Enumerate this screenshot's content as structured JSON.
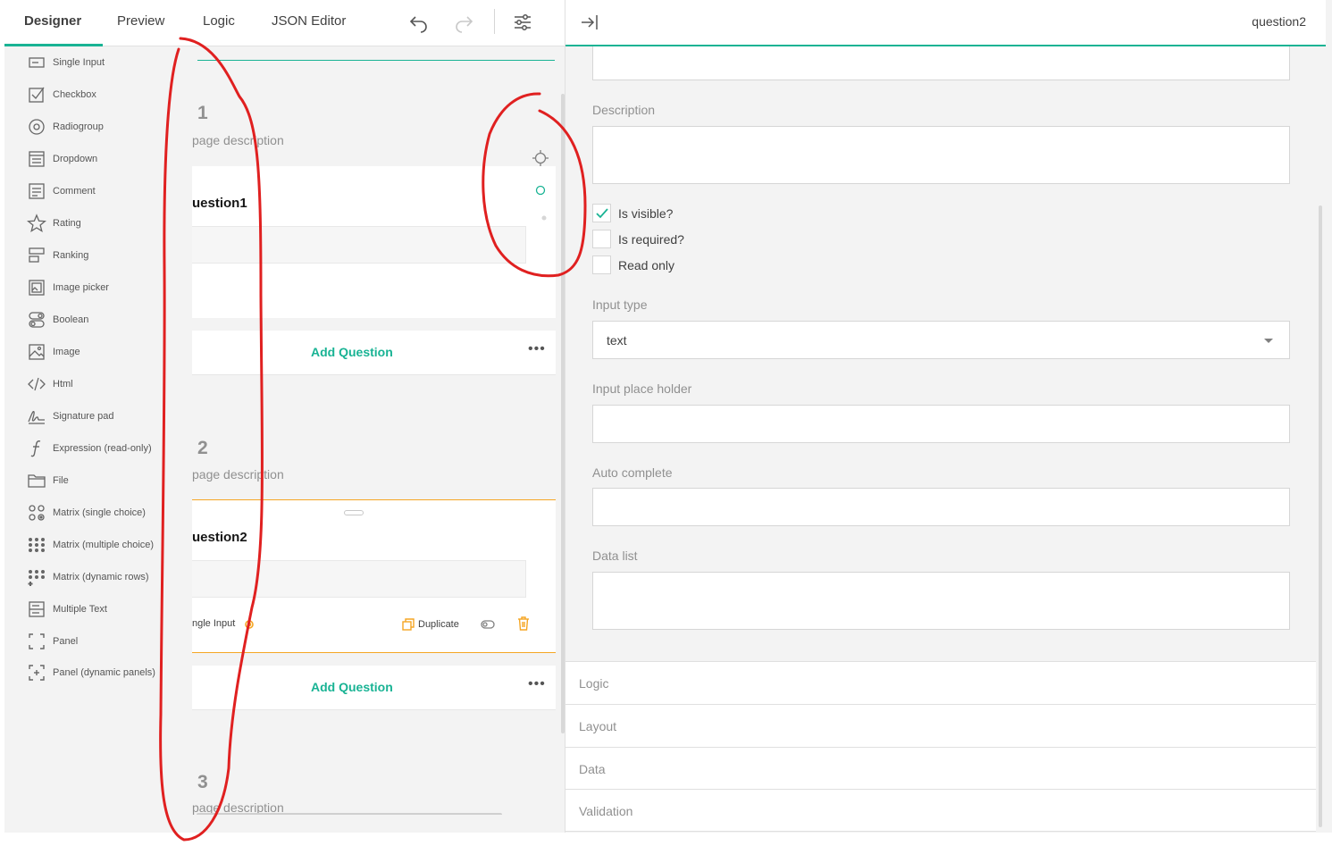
{
  "tabs": [
    {
      "label": "Designer",
      "active": true
    },
    {
      "label": "Preview",
      "active": false
    },
    {
      "label": "Logic",
      "active": false
    },
    {
      "label": "JSON Editor",
      "active": false
    }
  ],
  "accent_color": "#19b394",
  "warning_color": "#f5a623",
  "annotation_color": "#e02020",
  "toolbox": [
    {
      "label": "Single Input",
      "icon": "single-input-icon"
    },
    {
      "label": "Checkbox",
      "icon": "checkbox-icon"
    },
    {
      "label": "Radiogroup",
      "icon": "radiogroup-icon"
    },
    {
      "label": "Dropdown",
      "icon": "dropdown-icon"
    },
    {
      "label": "Comment",
      "icon": "comment-icon"
    },
    {
      "label": "Rating",
      "icon": "star-icon"
    },
    {
      "label": "Ranking",
      "icon": "ranking-icon"
    },
    {
      "label": "Image picker",
      "icon": "image-picker-icon"
    },
    {
      "label": "Boolean",
      "icon": "boolean-icon"
    },
    {
      "label": "Image",
      "icon": "image-icon"
    },
    {
      "label": "Html",
      "icon": "code-icon"
    },
    {
      "label": "Signature pad",
      "icon": "signature-icon"
    },
    {
      "label": "Expression (read-only)",
      "icon": "expression-icon"
    },
    {
      "label": "File",
      "icon": "folder-icon"
    },
    {
      "label": "Matrix (single choice)",
      "icon": "matrix-single-icon"
    },
    {
      "label": "Matrix (multiple choice)",
      "icon": "matrix-multiple-icon"
    },
    {
      "label": "Matrix (dynamic rows)",
      "icon": "matrix-dynamic-icon"
    },
    {
      "label": "Multiple Text",
      "icon": "multiple-text-icon"
    },
    {
      "label": "Panel",
      "icon": "panel-icon"
    },
    {
      "label": "Panel (dynamic panels)",
      "icon": "panel-dynamic-icon"
    }
  ],
  "canvas": {
    "pages": [
      {
        "title": "1",
        "description": "page description",
        "question": "uestion1"
      },
      {
        "title": "2",
        "description": "page description",
        "question": "uestion2"
      },
      {
        "title": "3",
        "description": "page description"
      }
    ],
    "add_question_label": "Add Question",
    "more_dots": "•••",
    "q2_toolbar": {
      "type_label": "ngle Input",
      "duplicate_label": "Duplicate"
    }
  },
  "properties": {
    "title": "question2",
    "description_label": "Description",
    "checkboxes": [
      {
        "label": "Is visible?",
        "checked": true
      },
      {
        "label": "Is required?",
        "checked": false
      },
      {
        "label": "Read only",
        "checked": false
      }
    ],
    "input_type_label": "Input type",
    "input_type_value": "text",
    "placeholder_label": "Input place holder",
    "autocomplete_label": "Auto complete",
    "datalist_label": "Data list",
    "sections": [
      "Logic",
      "Layout",
      "Data",
      "Validation"
    ]
  }
}
